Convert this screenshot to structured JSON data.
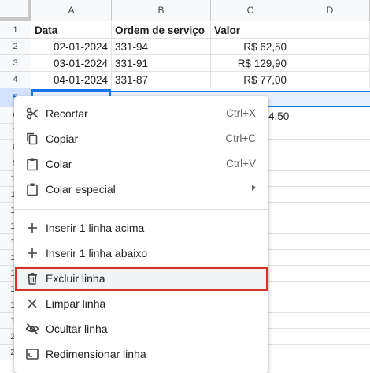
{
  "columns": [
    "A",
    "B",
    "C",
    "D"
  ],
  "rows": [
    "1",
    "2",
    "3",
    "4",
    "5",
    "6",
    "7",
    "8",
    "9",
    "10",
    "11",
    "12",
    "13",
    "14",
    "15",
    "16",
    "17",
    "18",
    "19",
    "20",
    "21"
  ],
  "selected_row": "5",
  "table": {
    "headers": [
      "Data",
      "Ordem de serviço",
      "Valor"
    ],
    "data": [
      [
        "02-01-2024",
        "331-94",
        "R$ 62,50"
      ],
      [
        "03-01-2024",
        "331-91",
        "R$ 129,90"
      ],
      [
        "04-01-2024",
        "331-87",
        "R$ 77,00"
      ]
    ],
    "row6_partial": "4,50"
  },
  "context_menu": {
    "items": [
      {
        "label": "Recortar",
        "shortcut": "Ctrl+X",
        "icon": "scissors-icon"
      },
      {
        "label": "Copiar",
        "shortcut": "Ctrl+C",
        "icon": "copy-icon"
      },
      {
        "label": "Colar",
        "shortcut": "Ctrl+V",
        "icon": "clipboard-icon"
      },
      {
        "label": "Colar especial",
        "shortcut": "",
        "icon": "clipboard-icon",
        "submenu": true
      },
      {
        "label": "Inserir 1 linha acima",
        "shortcut": "",
        "icon": "plus-icon"
      },
      {
        "label": "Inserir 1 linha abaixo",
        "shortcut": "",
        "icon": "plus-icon"
      },
      {
        "label": "Excluir linha",
        "shortcut": "",
        "icon": "trash-icon",
        "highlighted": true
      },
      {
        "label": "Limpar linha",
        "shortcut": "",
        "icon": "close-icon"
      },
      {
        "label": "Ocultar linha",
        "shortcut": "",
        "icon": "eye-off-icon"
      },
      {
        "label": "Redimensionar linha",
        "shortcut": "",
        "icon": "resize-icon"
      }
    ]
  },
  "colors": {
    "selection_accent": "#1a73e8",
    "highlight_box": "#d93025"
  }
}
